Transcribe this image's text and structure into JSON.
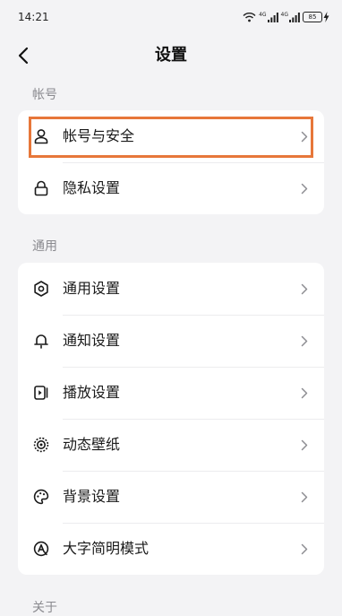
{
  "status_bar": {
    "time": "14:21",
    "signal1_label": "4G",
    "signal2_label": "4G",
    "battery": "85",
    "icons": [
      "wifi-icon",
      "signal-icon",
      "signal-icon",
      "battery-icon",
      "charging-icon"
    ]
  },
  "header": {
    "title": "设置",
    "back_icon": "chevron-left-icon"
  },
  "sections": {
    "account": {
      "label": "帐号",
      "items": [
        {
          "label": "帐号与安全",
          "icon": "person-icon"
        },
        {
          "label": "隐私设置",
          "icon": "lock-icon"
        }
      ]
    },
    "general": {
      "label": "通用",
      "items": [
        {
          "label": "通用设置",
          "icon": "gear-icon"
        },
        {
          "label": "通知设置",
          "icon": "bell-icon"
        },
        {
          "label": "播放设置",
          "icon": "play-settings-icon"
        },
        {
          "label": "动态壁纸",
          "icon": "dynamic-wallpaper-icon"
        },
        {
          "label": "背景设置",
          "icon": "palette-icon"
        },
        {
          "label": "大字简明模式",
          "icon": "large-font-icon"
        }
      ]
    },
    "about": {
      "label": "关于"
    }
  },
  "colors": {
    "background": "#f3f3f5",
    "card": "#ffffff",
    "highlight": "#e7773a",
    "section_label": "#8a8a8f"
  }
}
